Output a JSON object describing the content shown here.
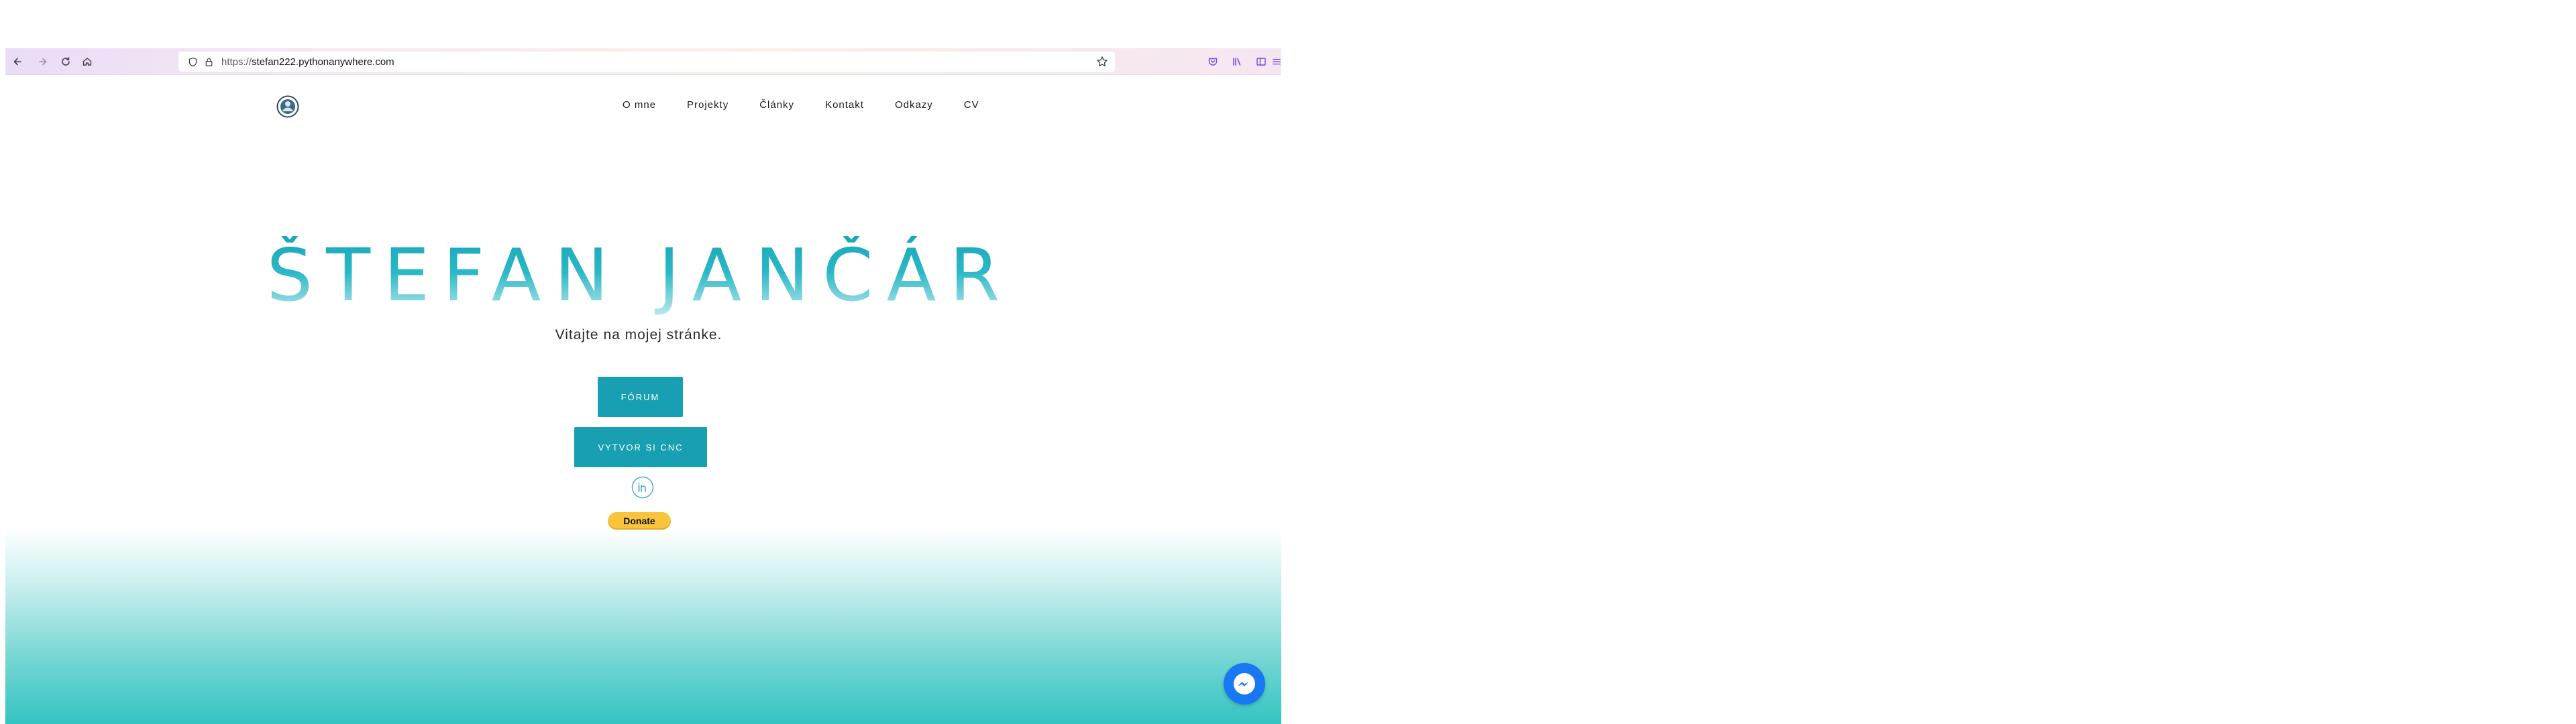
{
  "browser": {
    "url_scheme": "https://",
    "url_host": "stefan222.pythonanywhere.com",
    "icons": [
      "back-icon",
      "forward-icon",
      "reload-icon",
      "home-icon",
      "shield-icon",
      "lock-icon",
      "bookmark-star-icon",
      "pocket-icon",
      "library-icon",
      "sidebar-icon",
      "menu-icon"
    ]
  },
  "nav": {
    "items": [
      "O mne",
      "Projekty",
      "Články",
      "Kontakt",
      "Odkazy",
      "CV"
    ]
  },
  "hero": {
    "title": "ŠTEFAN JANČÁR",
    "subtitle": "Vitajte na mojej stránke.",
    "forum_button": "FÓRUM",
    "cnc_button": "VYTVOR SI CNC",
    "donate": "Donate"
  },
  "colors": {
    "accent": "#18a0b2",
    "gradient_bottom": "#33c3c1",
    "donate": "#f7c43c",
    "messenger": "#1877f2"
  }
}
